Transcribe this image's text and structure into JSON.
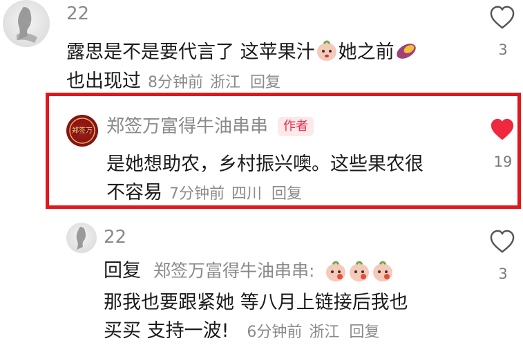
{
  "comments": [
    {
      "username": "22",
      "text_line1a": "露思是不是要代言了 这苹果汁",
      "text_line1b": "她之前",
      "text_line2": "也出现过",
      "time": "8分钟前",
      "location": "浙江",
      "reply": "回复",
      "like_count": "3"
    },
    {
      "username": "郑签万富得牛油串串",
      "author_tag": "作者",
      "avatar_text": "郑签万",
      "text_line1": "是她想助农，乡村振兴噢。这些果农很",
      "text_line2": "不容易",
      "time": "7分钟前",
      "location": "四川",
      "reply": "回复",
      "like_count": "19"
    },
    {
      "username": "22",
      "reply_prefix": "回复",
      "reply_to": "郑签万富得牛油串串:",
      "text_line2": "那我也要跟紧她 等八月上链接后我也",
      "text_line3": "买买 支持一波!",
      "time": "6分钟前",
      "location": "浙江",
      "reply": "回复",
      "like_count": "3"
    }
  ],
  "colors": {
    "highlight_border": "#e2161b",
    "liked_heart": "#f0283d",
    "author_tag_text": "#e8304a",
    "author_tag_bg": "#fde8ea",
    "meta_gray": "#8a8a8a"
  },
  "icons": {
    "like": "heart-outline-icon",
    "liked": "heart-filled-icon",
    "emoji_peach": "peach-emoji-icon",
    "emoji_sweet_potato": "sweet-potato-emoji-icon"
  }
}
